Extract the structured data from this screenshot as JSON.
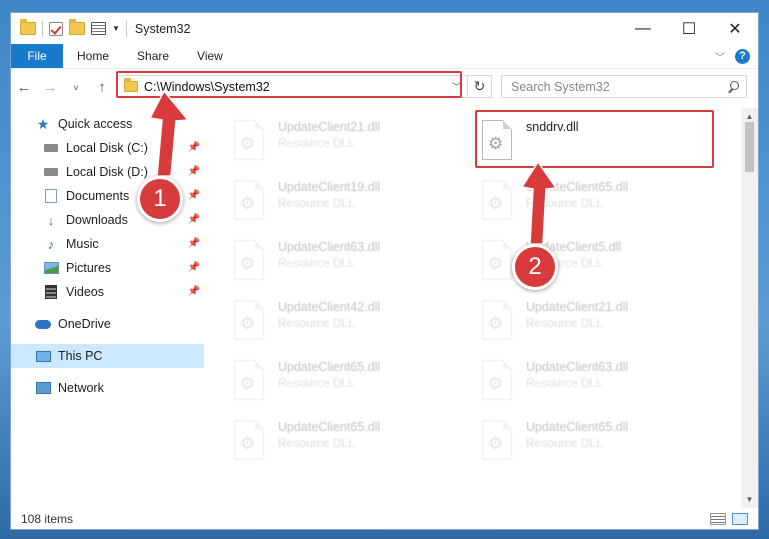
{
  "window": {
    "title": "System32"
  },
  "ribbon": {
    "tabs": [
      "File",
      "Home",
      "Share",
      "View"
    ]
  },
  "address": {
    "path": "C:\\Windows\\System32"
  },
  "search": {
    "placeholder": "Search System32"
  },
  "sidebar": {
    "items": [
      {
        "label": "Quick access",
        "icon": "star-icon"
      },
      {
        "label": "Local Disk (C:)",
        "icon": "drive-icon",
        "pinned": true
      },
      {
        "label": "Local Disk (D:)",
        "icon": "drive-icon",
        "pinned": true
      },
      {
        "label": "Documents",
        "icon": "documents-icon",
        "pinned": true
      },
      {
        "label": "Downloads",
        "icon": "downloads-icon",
        "pinned": true
      },
      {
        "label": "Music",
        "icon": "music-icon",
        "pinned": true
      },
      {
        "label": "Pictures",
        "icon": "pictures-icon",
        "pinned": true
      },
      {
        "label": "Videos",
        "icon": "videos-icon",
        "pinned": true
      },
      {
        "label": "OneDrive",
        "icon": "onedrive-icon"
      },
      {
        "label": "This PC",
        "icon": "this-pc-icon",
        "selected": true
      },
      {
        "label": "Network",
        "icon": "network-icon"
      }
    ]
  },
  "files": [
    {
      "name": "UpdateClient21.dll",
      "desc": "Resource DLL",
      "faded": true
    },
    {
      "name": "snddrv.dll",
      "desc": "",
      "faded": false,
      "highlighted": true
    },
    {
      "name": "UpdateClient19.dll",
      "desc": "Resource DLL",
      "faded": true
    },
    {
      "name": "UpdateClient65.dll",
      "desc": "Resource DLL",
      "faded": true
    },
    {
      "name": "UpdateClient63.dll",
      "desc": "Resource DLL",
      "faded": true
    },
    {
      "name": "UpdateClient5.dll",
      "desc": "Resource DLL",
      "faded": true
    },
    {
      "name": "UpdateClient42.dll",
      "desc": "Resource DLL",
      "faded": true
    },
    {
      "name": "UpdateClient21.dll",
      "desc": "Resource DLL",
      "faded": true
    },
    {
      "name": "UpdateClient65.dll",
      "desc": "Resource DLL",
      "faded": true
    },
    {
      "name": "UpdateClient63.dll",
      "desc": "Resource DLL",
      "faded": true
    },
    {
      "name": "UpdateClient65.dll",
      "desc": "Resource DLL",
      "faded": true
    },
    {
      "name": "UpdateClient65.dll",
      "desc": "Resource DLL",
      "faded": true
    }
  ],
  "status": {
    "item_count": "108 items"
  },
  "annotations": {
    "step1": "1",
    "step2": "2"
  },
  "colors": {
    "accent": "#1979ca",
    "highlight": "#d83b3b",
    "selection": "#cce8ff"
  }
}
